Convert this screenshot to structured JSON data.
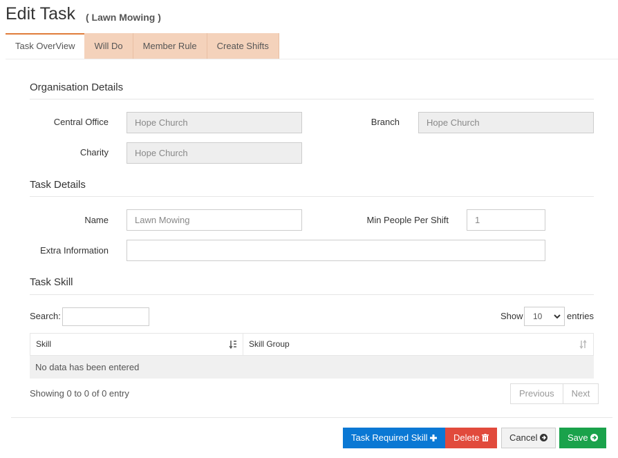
{
  "header": {
    "title": "Edit Task",
    "subtitle": "( Lawn Mowing )"
  },
  "tabs": [
    {
      "label": "Task OverView",
      "active": true
    },
    {
      "label": "Will Do",
      "active": false
    },
    {
      "label": "Member Rule",
      "active": false
    },
    {
      "label": "Create Shifts",
      "active": false
    }
  ],
  "organisation": {
    "title": "Organisation Details",
    "central_office_label": "Central Office",
    "central_office_value": "Hope Church",
    "branch_label": "Branch",
    "branch_value": "Hope Church",
    "charity_label": "Charity",
    "charity_value": "Hope Church"
  },
  "task_details": {
    "title": "Task Details",
    "name_label": "Name",
    "name_value": "Lawn Mowing",
    "min_people_label": "Min People Per Shift",
    "min_people_value": "1",
    "extra_info_label": "Extra Information",
    "extra_info_value": ""
  },
  "task_skill": {
    "title": "Task Skill",
    "search_label": "Search:",
    "show_label": "Show",
    "entries_value": "10",
    "entries_label": "entries",
    "columns": [
      "Skill",
      "Skill Group"
    ],
    "empty_text": "No data has been entered",
    "info_text": "Showing 0 to 0 of 0 entry",
    "prev_label": "Previous",
    "next_label": "Next"
  },
  "actions": {
    "task_required_skill": "Task Required Skill",
    "delete": "Delete",
    "cancel": "Cancel",
    "save": "Save"
  },
  "colors": {
    "tab_inactive": "#f4d2bb",
    "tab_accent": "#e07b39",
    "primary": "#0a78d4",
    "danger": "#e14a3c",
    "success": "#1aa24b"
  }
}
